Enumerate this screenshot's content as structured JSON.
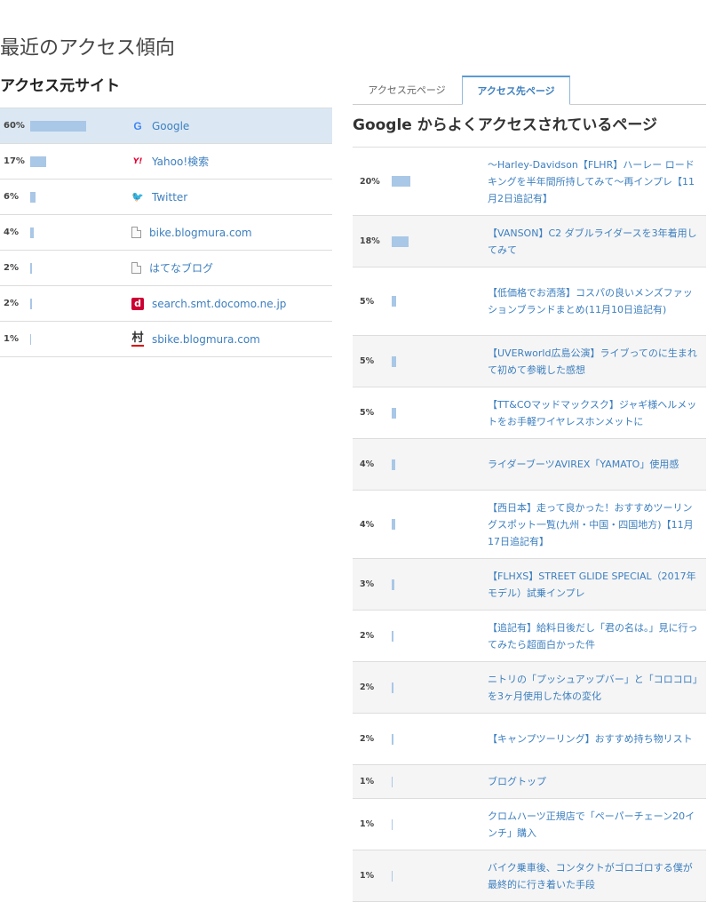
{
  "page_title": "最近のアクセス傾向",
  "referrers": {
    "title": "アクセス元サイト",
    "rows": [
      {
        "percent": "60%",
        "value": 60,
        "icon": "google-icon",
        "icon_glyph": "G",
        "site": "Google",
        "active": true
      },
      {
        "percent": "17%",
        "value": 17,
        "icon": "yahoo-icon",
        "icon_glyph": "Y!",
        "site": "Yahoo!検索"
      },
      {
        "percent": "6%",
        "value": 6,
        "icon": "twitter-icon",
        "icon_glyph": "🐦",
        "site": "Twitter"
      },
      {
        "percent": "4%",
        "value": 4,
        "icon": "page-icon",
        "icon_glyph": "",
        "site": "bike.blogmura.com"
      },
      {
        "percent": "2%",
        "value": 2,
        "icon": "page-icon",
        "icon_glyph": "",
        "site": "はてなブログ"
      },
      {
        "percent": "2%",
        "value": 2,
        "icon": "docomo-icon",
        "icon_glyph": "d",
        "site": "search.smt.docomo.ne.jp"
      },
      {
        "percent": "1%",
        "value": 1,
        "icon": "blogmura-icon",
        "icon_glyph": "村",
        "site": "sbike.blogmura.com"
      }
    ]
  },
  "tabs": [
    {
      "label": "アクセス元ページ",
      "active": false
    },
    {
      "label": "アクセス先ページ",
      "active": true
    }
  ],
  "destinations": {
    "title": "Google からよくアクセスされているページ",
    "rows": [
      {
        "percent": "20%",
        "value": 20,
        "lines": 3,
        "title": "〜Harley-Davidson【FLHR】ハーレー ロードキングを半年間所持してみて〜再インプレ【11月2日追記有】"
      },
      {
        "percent": "18%",
        "value": 18,
        "lines": 2,
        "title": "【VANSON】C2 ダブルライダースを3年着用してみて"
      },
      {
        "percent": "5%",
        "value": 5,
        "lines": 3,
        "title": "【低価格でお洒落】コスパの良いメンズファッションブランドまとめ(11月10日追記有)"
      },
      {
        "percent": "5%",
        "value": 5,
        "lines": 2,
        "title": "【UVERworld広島公演】ライブってのに生まれて初めて参戦した感想"
      },
      {
        "percent": "5%",
        "value": 5,
        "lines": 2,
        "title": "【TT&COマッドマックスク】ジャギ様ヘルメットをお手軽ワイヤレスホンメットに"
      },
      {
        "percent": "4%",
        "value": 4,
        "lines": 2,
        "title": "ライダーブーツAVIREX「YAMATO」使用感"
      },
      {
        "percent": "4%",
        "value": 4,
        "lines": 3,
        "title": "【西日本】走って良かった！おすすめツーリングスポット一覧(九州・中国・四国地方)【11月17日追記有】"
      },
      {
        "percent": "3%",
        "value": 3,
        "lines": 2,
        "title": "【FLHXS】STREET GLIDE SPECIAL（2017年モデル）試乗インプレ"
      },
      {
        "percent": "2%",
        "value": 2,
        "lines": 2,
        "title": "【追記有】給料日後だし「君の名は。」見に行ってみたら超面白かった件"
      },
      {
        "percent": "2%",
        "value": 2,
        "lines": 2,
        "title": "ニトリの「プッシュアップバー」と「コロコロ」を3ヶ月使用した体の変化"
      },
      {
        "percent": "2%",
        "value": 2,
        "lines": 2,
        "title": "【キャンプツーリング】おすすめ持ち物リスト"
      },
      {
        "percent": "1%",
        "value": 1,
        "lines": 1,
        "title": "ブログトップ"
      },
      {
        "percent": "1%",
        "value": 1,
        "lines": 2,
        "title": "クロムハーツ正規店で「ペーパーチェーン20インチ」購入"
      },
      {
        "percent": "1%",
        "value": 1,
        "lines": 2,
        "title": "バイク乗車後、コンタクトがゴロゴロする僕が最終的に行き着いた手段"
      }
    ]
  },
  "colors": {
    "bar": "#a9c7e6",
    "link": "#3d7fbf",
    "active_row": "#dbe8f4"
  }
}
